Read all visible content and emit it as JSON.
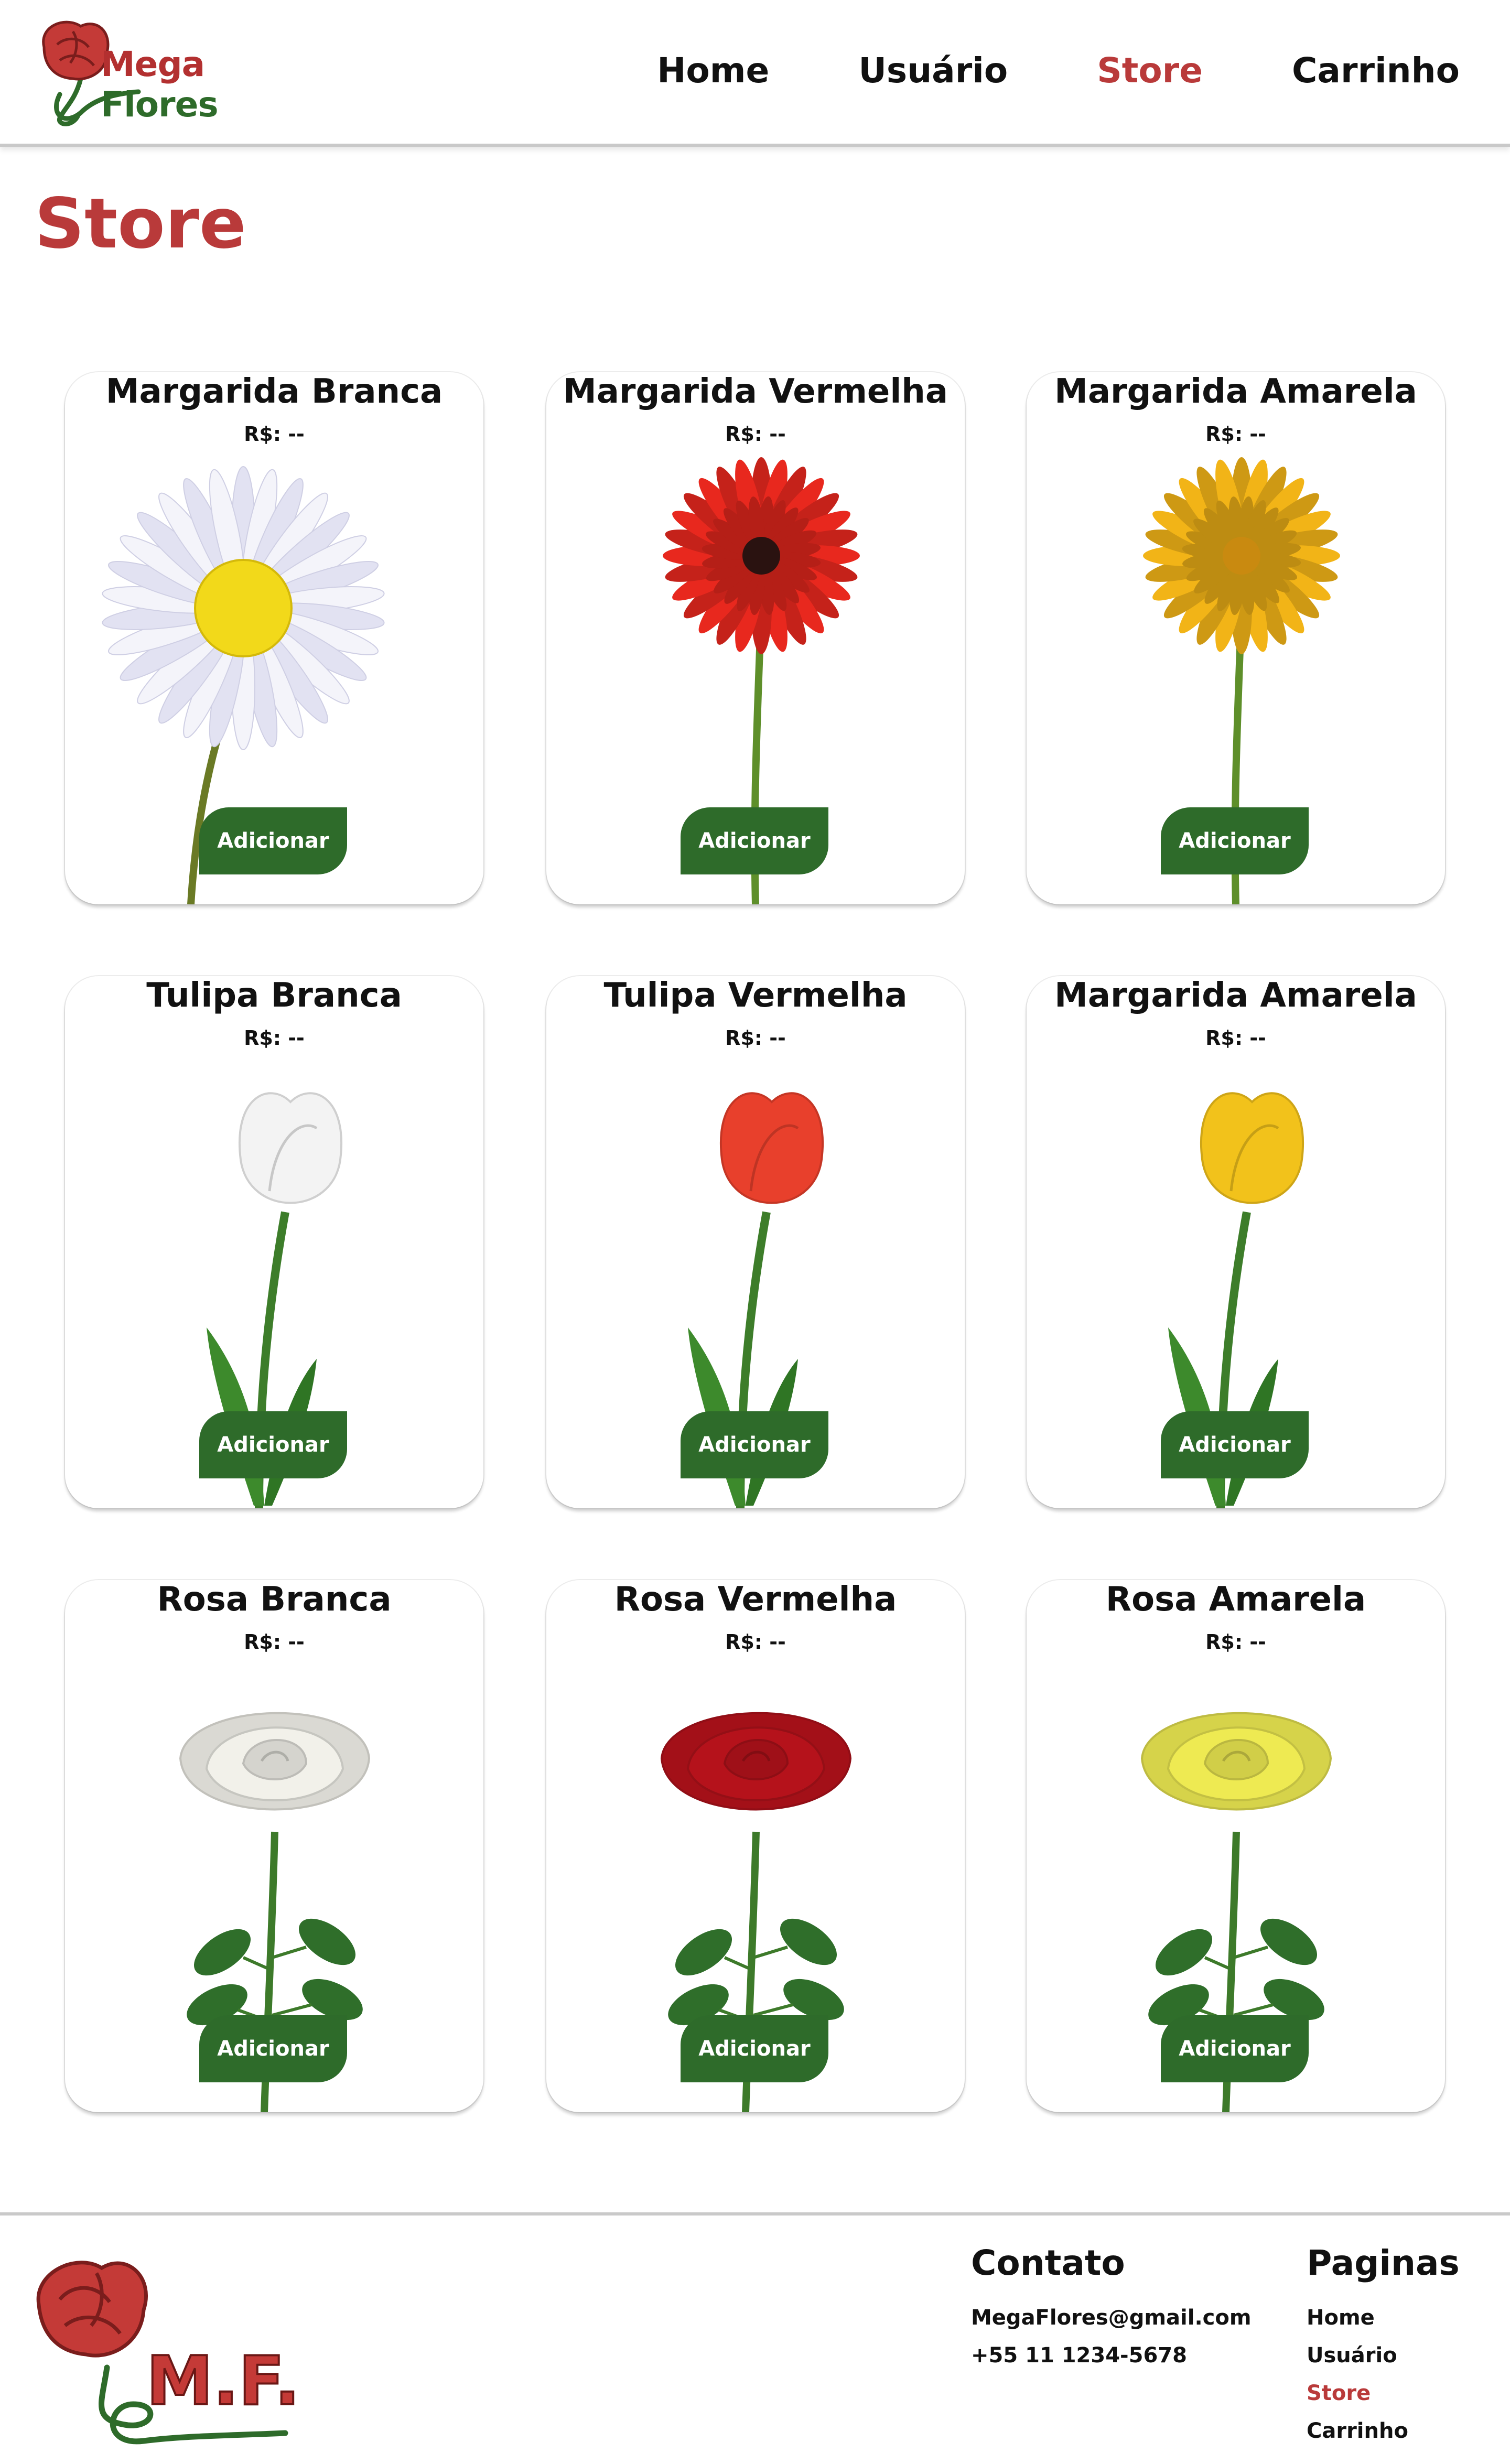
{
  "brand": {
    "word1": "Mega",
    "word2": "Flores",
    "footer_mark": "M.F.",
    "colors": {
      "red": "#b93a3a",
      "green": "#2e6b2a"
    }
  },
  "nav": {
    "items": [
      {
        "label": "Home",
        "active": false
      },
      {
        "label": "Usuário",
        "active": false
      },
      {
        "label": "Store",
        "active": true
      },
      {
        "label": "Carrinho",
        "active": false
      }
    ]
  },
  "page": {
    "title": "Store"
  },
  "products": [
    {
      "name": "Margarida Branca",
      "price": "R$: --",
      "button": "Adicionar",
      "flower": "daisy",
      "color": "#f4f4fa"
    },
    {
      "name": "Margarida Vermelha",
      "price": "R$: --",
      "button": "Adicionar",
      "flower": "gerbera",
      "color": "#e8281e"
    },
    {
      "name": "Margarida Amarela",
      "price": "R$: --",
      "button": "Adicionar",
      "flower": "gerbera",
      "color": "#f2b417"
    },
    {
      "name": "Tulipa Branca",
      "price": "R$: --",
      "button": "Adicionar",
      "flower": "tulip",
      "color": "#f3f3f3"
    },
    {
      "name": "Tulipa Vermelha",
      "price": "R$: --",
      "button": "Adicionar",
      "flower": "tulip",
      "color": "#e8402c"
    },
    {
      "name": "Margarida Amarela",
      "price": "R$: --",
      "button": "Adicionar",
      "flower": "tulip",
      "color": "#f2c21b"
    },
    {
      "name": "Rosa Branca",
      "price": "R$: --",
      "button": "Adicionar",
      "flower": "rose",
      "color": "#f2f1ea"
    },
    {
      "name": "Rosa Vermelha",
      "price": "R$: --",
      "button": "Adicionar",
      "flower": "rose",
      "color": "#b5121b"
    },
    {
      "name": "Rosa Amarela",
      "price": "R$: --",
      "button": "Adicionar",
      "flower": "rose",
      "color": "#eeea52"
    }
  ],
  "footer": {
    "contato": {
      "title": "Contato",
      "email": "MegaFlores@gmail.com",
      "phone": "+55 11 1234-5678"
    },
    "paginas": {
      "title": "Paginas",
      "links": [
        "Home",
        "Usuário",
        "Store",
        "Carrinho"
      ],
      "active": "Store"
    }
  }
}
